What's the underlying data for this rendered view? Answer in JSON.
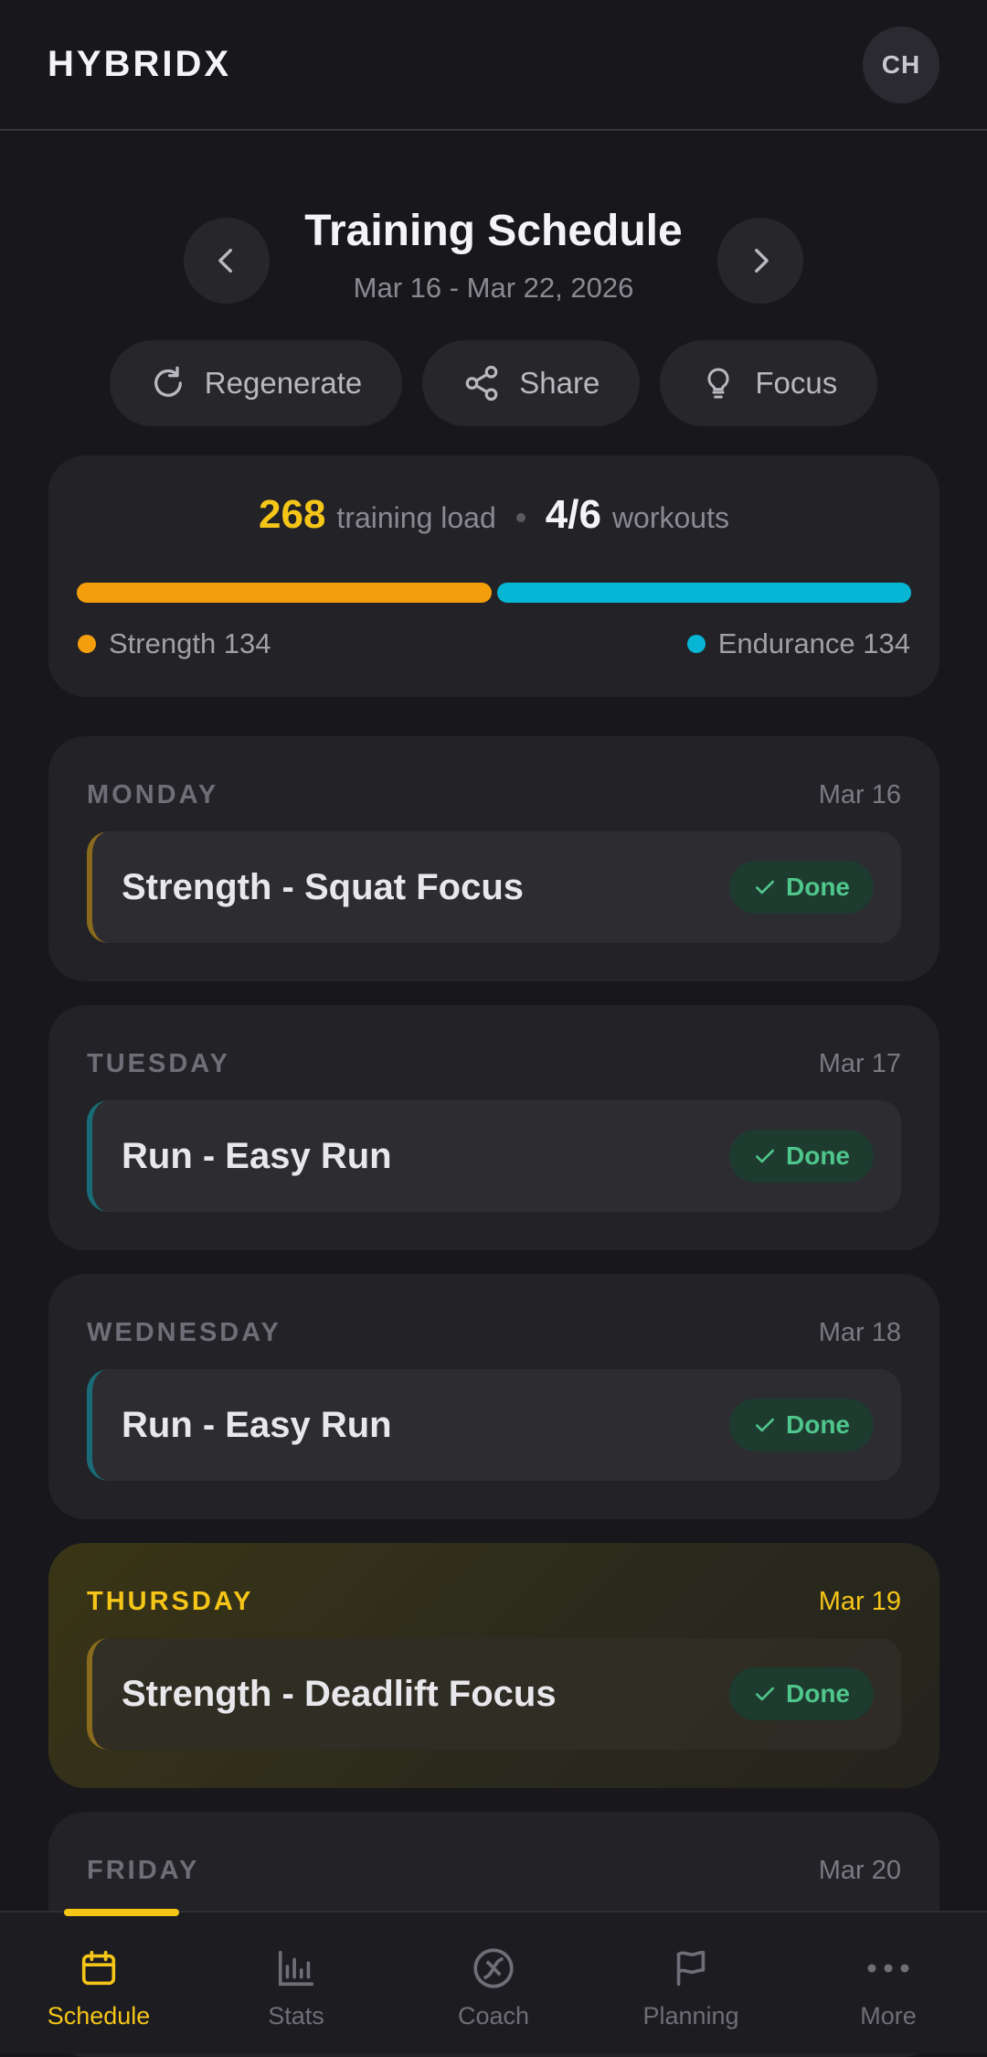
{
  "app": {
    "brand": "HYBRIDX",
    "avatar_initials": "CH"
  },
  "week": {
    "title": "Training Schedule",
    "range": "Mar 16 - Mar 22, 2026",
    "prev_icon": "chevron-left-icon",
    "next_icon": "chevron-right-icon"
  },
  "actions": [
    {
      "label": "Regenerate",
      "icon": "refresh-icon"
    },
    {
      "label": "Share",
      "icon": "share-icon"
    },
    {
      "label": "Focus",
      "icon": "lightbulb-icon"
    }
  ],
  "summary": {
    "load_value": "268",
    "load_label": "training load",
    "workouts_value": "4/6",
    "workouts_label": "workouts",
    "strength_label": "Strength 134",
    "endurance_label": "Endurance 134",
    "strength_share": 0.5,
    "endurance_share": 0.5
  },
  "days": [
    {
      "name": "MONDAY",
      "date": "Mar 16",
      "workout": "Strength - Squat Focus",
      "status": "Done",
      "kind": "strength"
    },
    {
      "name": "TUESDAY",
      "date": "Mar 17",
      "workout": "Run - Easy Run",
      "status": "Done",
      "kind": "endurance"
    },
    {
      "name": "WEDNESDAY",
      "date": "Mar 18",
      "workout": "Run - Easy Run",
      "status": "Done",
      "kind": "endurance"
    },
    {
      "name": "THURSDAY",
      "date": "Mar 19",
      "workout": "Strength - Deadlift Focus",
      "status": "Done",
      "kind": "strength",
      "today": true
    },
    {
      "name": "FRIDAY",
      "date": "Mar 20"
    }
  ],
  "tabs": [
    {
      "label": "Schedule",
      "icon": "calendar-icon",
      "active": true
    },
    {
      "label": "Stats",
      "icon": "bar-chart-icon"
    },
    {
      "label": "Coach",
      "icon": "coach-icon"
    },
    {
      "label": "Planning",
      "icon": "flag-icon"
    },
    {
      "label": "More",
      "icon": "more-dots-icon"
    }
  ],
  "colors": {
    "accent": "#f5c518",
    "strength": "#f59e0b",
    "endurance": "#06b6d4",
    "done_text": "#4fc68b",
    "background": "#18181c"
  }
}
